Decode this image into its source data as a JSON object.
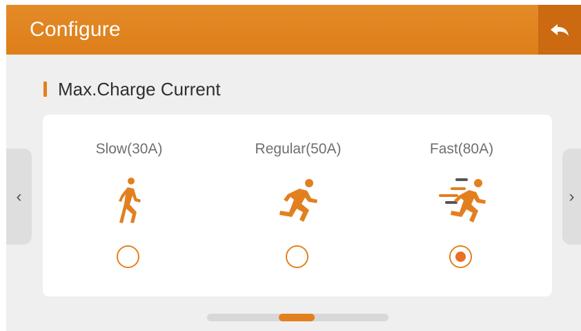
{
  "header": {
    "title": "Configure",
    "background_color": "#e48a27",
    "back_icon": "back-arrow-icon"
  },
  "section": {
    "title": "Max.Charge Current",
    "marker_color": "#e2801f"
  },
  "navigation": {
    "prev_glyph": "‹",
    "next_glyph": "›"
  },
  "options": [
    {
      "label": "Slow(30A)",
      "icon": "walking-person-icon",
      "selected": false
    },
    {
      "label": "Regular(50A)",
      "icon": "running-person-icon",
      "selected": false
    },
    {
      "label": "Fast(80A)",
      "icon": "fast-running-person-icon",
      "selected": true
    }
  ],
  "pager": {
    "pages": 3,
    "current_page": 2
  },
  "colors": {
    "accent": "#e2801f",
    "selected_radio": "#e86f24",
    "screen_background": "#efefef",
    "card_background": "#ffffff"
  }
}
